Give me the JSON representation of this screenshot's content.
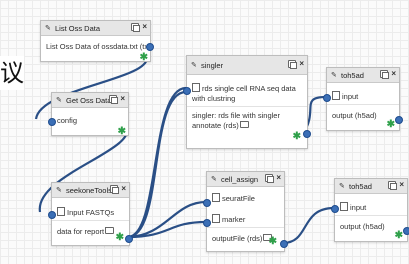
{
  "side_char": "议",
  "nodes": {
    "list_oss": {
      "title": "List Oss Data",
      "output": "List Oss Data of ossdata.txt (txt)"
    },
    "get_oss": {
      "title": "Get Oss Data",
      "input": "config"
    },
    "seekone": {
      "title": "seekoneTools",
      "input": "Input FASTQs",
      "output": "data for report"
    },
    "singler": {
      "title": "singler",
      "input": "rds single cell RNA seq data with clustring",
      "output": "singler: rds file with singler annotate (rds)"
    },
    "cell_assign": {
      "title": "cell_assign",
      "input1": "seuratFile",
      "input2": "marker",
      "output": "outputFile (rds)"
    },
    "toh5ad_top": {
      "title": "toh5ad",
      "input": "input",
      "output": "output (h5ad)"
    },
    "toh5ad_bottom": {
      "title": "toh5ad",
      "input": "input",
      "output": "output (h5ad)"
    }
  },
  "icons": {
    "header_left": "wrench-icon",
    "header_copy": "copy-icon",
    "header_close": "close-icon",
    "input_file": "file-icon",
    "output_folder": "folder-icon",
    "port": "connector-port",
    "terminal": "green-asterisk-icon"
  },
  "colors": {
    "link": "#2a4f86",
    "port": "#3b6fb6",
    "terminal": "#2fa04a",
    "header": "#e6e6e6"
  }
}
